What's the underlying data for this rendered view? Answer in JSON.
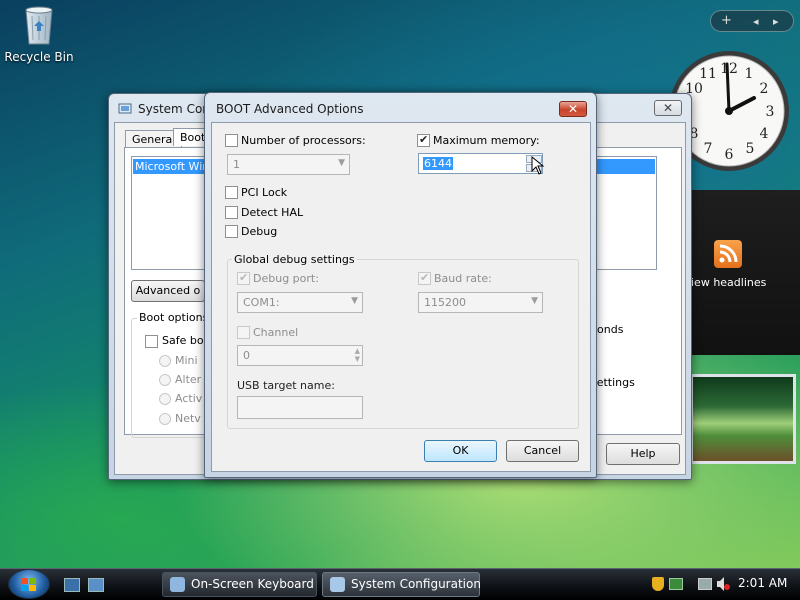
{
  "desktop": {
    "recycle_bin_label": "Recycle Bin"
  },
  "sidebar": {
    "add_gadget": "+",
    "prev": "◂",
    "next": "▸",
    "feed_text": "iew headlines",
    "clock_time": "2:01"
  },
  "sysconfig": {
    "title": "System Conf",
    "tabs": [
      "General",
      "Boot"
    ],
    "list_item": "Microsoft Wir",
    "advanced_button": "Advanced o",
    "boot_options_label": "Boot options",
    "safe_boot_label": "Safe bo",
    "radio_options": [
      "Mini",
      "Alter",
      "Activ",
      "Netv"
    ],
    "right_text_1": "conds",
    "right_text_2": "settings",
    "help_button": "Help"
  },
  "dialog": {
    "title": "BOOT Advanced Options",
    "num_processors": {
      "label": "Number of processors:",
      "checked": false,
      "value": "1"
    },
    "max_memory": {
      "label": "Maximum memory:",
      "checked": true,
      "value": "6144"
    },
    "pci_lock": {
      "label": "PCI Lock",
      "checked": false
    },
    "detect_hal": {
      "label": "Detect HAL",
      "checked": false
    },
    "debug": {
      "label": "Debug",
      "checked": false
    },
    "global_debug": {
      "title": "Global debug settings",
      "debug_port": {
        "label": "Debug port:",
        "checked": true,
        "value": "COM1:"
      },
      "baud_rate": {
        "label": "Baud rate:",
        "checked": true,
        "value": "115200"
      },
      "channel": {
        "label": "Channel",
        "checked": false,
        "value": "0"
      },
      "usb_target": {
        "label": "USB target name:",
        "value": ""
      }
    },
    "ok_button": "OK",
    "cancel_button": "Cancel"
  },
  "taskbar": {
    "items": [
      {
        "label": "On-Screen Keyboard"
      },
      {
        "label": "System Configuration"
      }
    ],
    "time": "2:01 AM"
  }
}
